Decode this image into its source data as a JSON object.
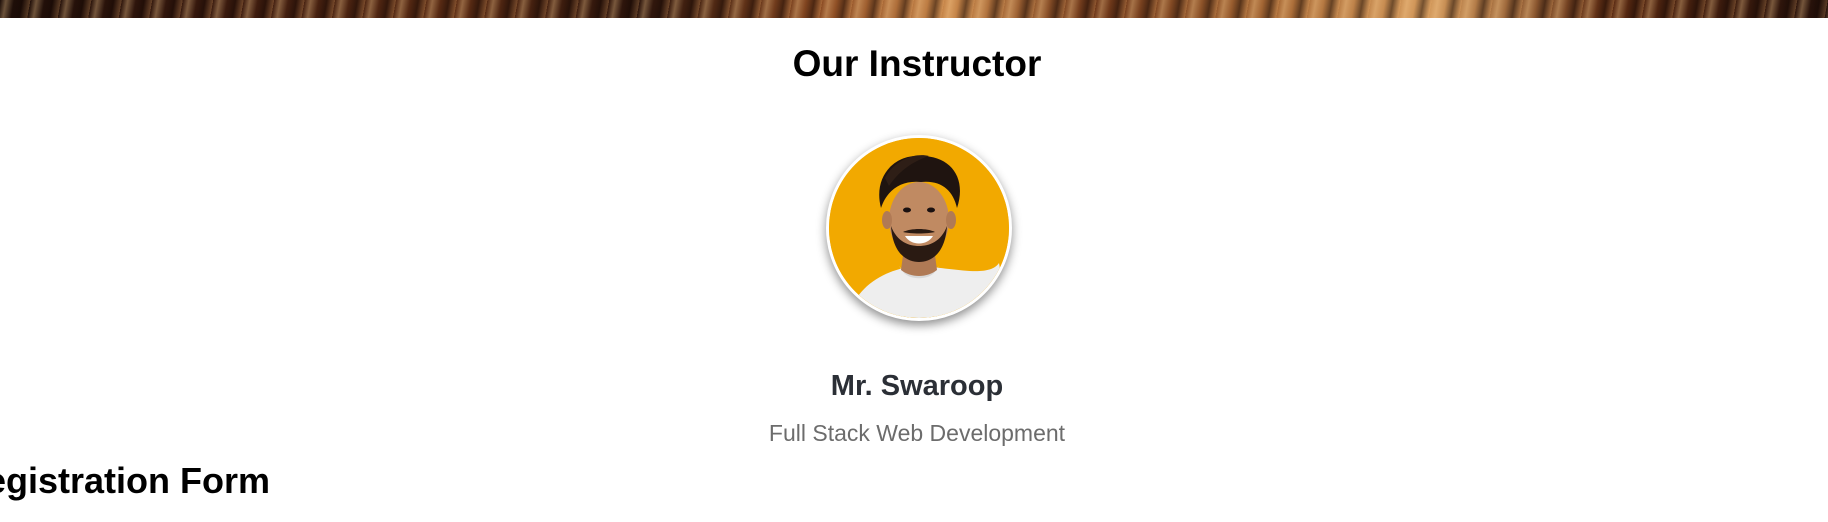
{
  "instructor_section": {
    "title": "Our Instructor",
    "instructor": {
      "name": "Mr. Swaroop",
      "role": "Full Stack Web Development",
      "avatar_background": "#f2a900"
    }
  },
  "registration": {
    "title": "egistration Form"
  },
  "colors": {
    "heading": "#000000",
    "name": "#2b2f36",
    "role": "#6c6c6c"
  }
}
